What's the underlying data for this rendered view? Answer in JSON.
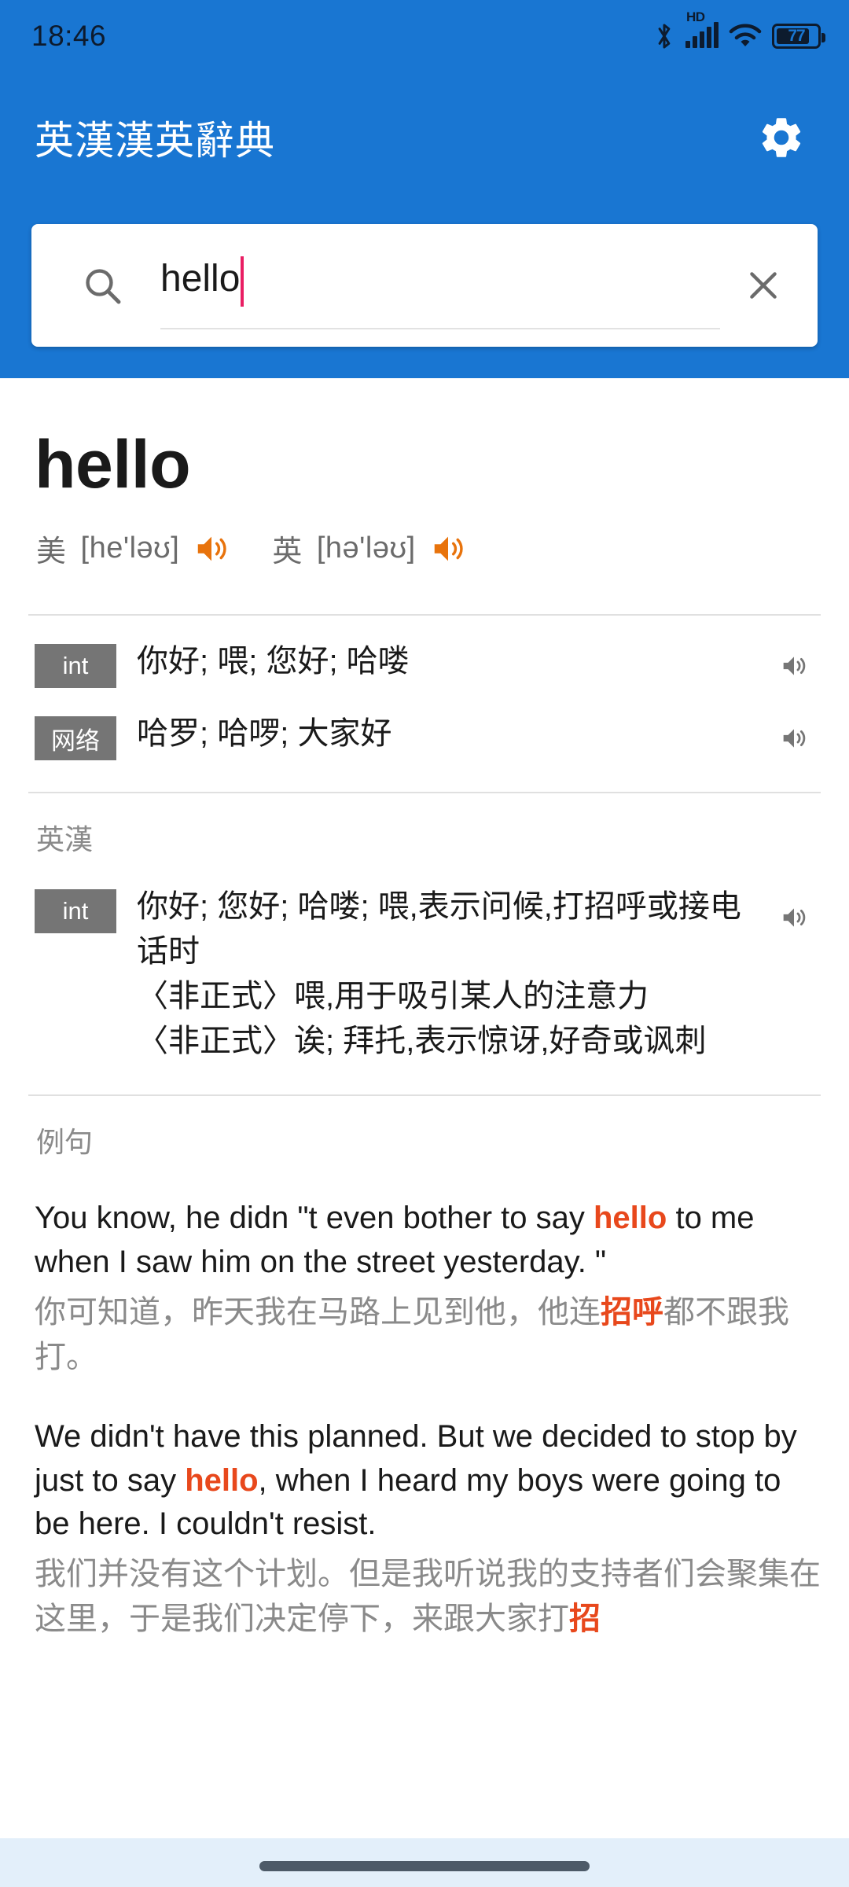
{
  "colors": {
    "header_blue": "#1976d2",
    "accent_orange": "#e8730c",
    "highlight_red": "#e8481c",
    "tag_gray": "#757575",
    "navbar_blue": "#e3effa"
  },
  "status_bar": {
    "clock": "18:46",
    "network_label": "HD",
    "battery_level": "77",
    "icons": [
      "bluetooth-icon",
      "signal-bars-icon",
      "wifi-icon",
      "battery-icon"
    ]
  },
  "app_bar": {
    "title": "英漢漢英辭典",
    "settings_icon": "gear-icon"
  },
  "search": {
    "value": "hello",
    "placeholder": "",
    "search_icon": "search-icon",
    "clear_icon": "close-icon"
  },
  "entry": {
    "headword": "hello",
    "pronunciations": [
      {
        "region": "美",
        "ipa": "[he'ləʊ]",
        "speaker_icon": "speaker-icon"
      },
      {
        "region": "英",
        "ipa": "[hə'ləʊ]",
        "speaker_icon": "speaker-icon"
      }
    ],
    "quick_definitions": [
      {
        "tag": "int",
        "text": "你好; 喂; 您好; 哈喽",
        "speaker_icon": "speaker-icon"
      },
      {
        "tag": "网络",
        "text": "哈罗; 哈啰; 大家好",
        "speaker_icon": "speaker-icon"
      }
    ],
    "dict_section": {
      "label": "英漢",
      "entries": [
        {
          "tag": "int",
          "text": "你好; 您好; 哈喽; 喂,表示问候,打招呼或接电话时\n〈非正式〉喂,用于吸引某人的注意力\n〈非正式〉诶; 拜托,表示惊讶,好奇或讽刺",
          "speaker_icon": "speaker-icon"
        }
      ]
    },
    "examples_section": {
      "label": "例句",
      "examples": [
        {
          "en_before": "You know, he didn \"t even bother to say ",
          "en_highlight": "hello",
          "en_after": " to me when I saw him on the street yesterday. \"",
          "zh_before": "你可知道，昨天我在马路上见到他，他连",
          "zh_highlight": "招呼",
          "zh_after": "都不跟我打。"
        },
        {
          "en_before": "We didn't have this planned. But we decided to stop by just to say ",
          "en_highlight": "hello",
          "en_after": ", when I heard my boys were going to be here. I couldn't resist.",
          "zh_before": "我们并没有这个计划。但是我听说我的支持者们会聚集在这里，于是我们决定停下，来跟大家打",
          "zh_highlight": "招",
          "zh_after": ""
        }
      ]
    }
  },
  "nav_bar": {
    "home_indicator": "home-indicator"
  }
}
